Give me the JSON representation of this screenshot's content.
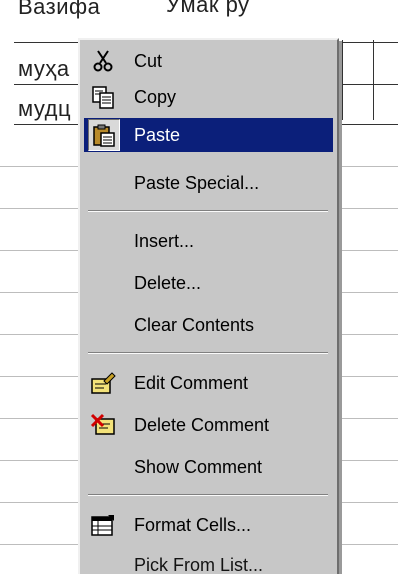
{
  "sheet": {
    "cells": [
      "Вазифа",
      "Ӯмак ру",
      "муҳа",
      "мудц"
    ]
  },
  "menu": {
    "items": [
      {
        "label": "Cut",
        "icon": "scissors-icon"
      },
      {
        "label": "Copy",
        "icon": "copy-icon"
      },
      {
        "label": "Paste",
        "icon": "clipboard-icon",
        "selected": true
      },
      {
        "label": "Paste Special..."
      },
      {
        "label": "Insert..."
      },
      {
        "label": "Delete..."
      },
      {
        "label": "Clear Contents"
      },
      {
        "label": "Edit Comment",
        "icon": "edit-comment-icon"
      },
      {
        "label": "Delete Comment",
        "icon": "delete-comment-icon"
      },
      {
        "label": "Show Comment"
      },
      {
        "label": "Format Cells...",
        "icon": "format-cells-icon"
      },
      {
        "label": "Pick From List..."
      }
    ]
  },
  "colors": {
    "menu_bg": "#c7c7c7",
    "highlight": "#0b1f7a",
    "highlight_text": "#ffffff"
  }
}
